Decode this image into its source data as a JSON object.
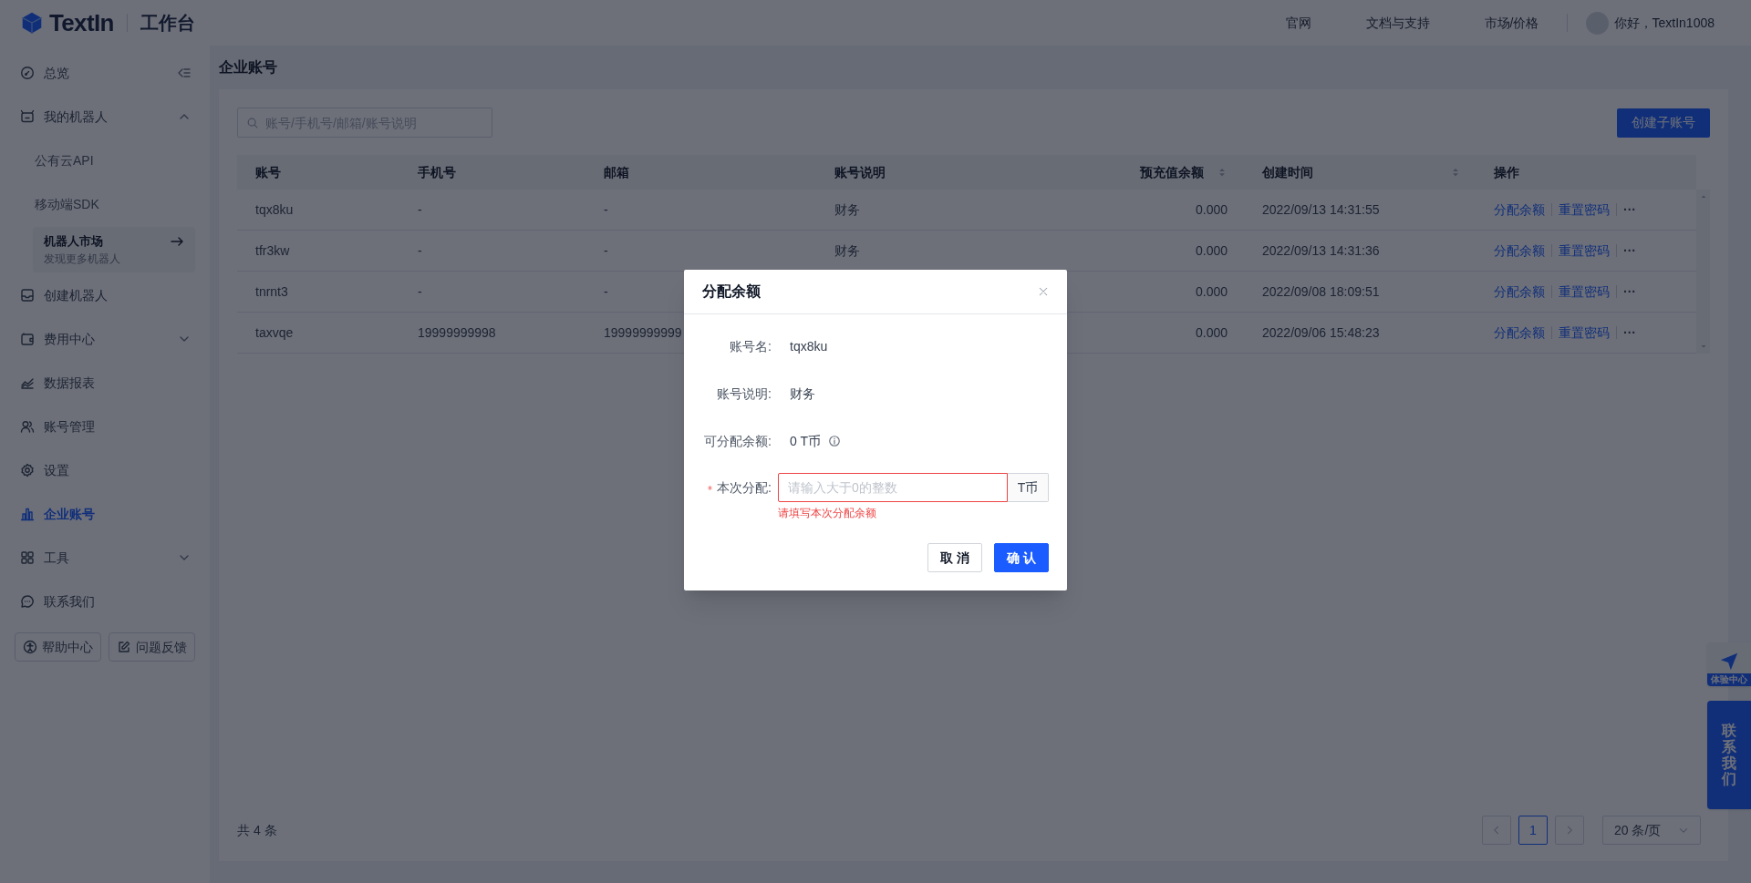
{
  "header": {
    "logo": "TextIn",
    "product": "工作台",
    "nav": [
      "官网",
      "文档与支持",
      "市场/价格"
    ],
    "greeting": "你好，TextIn1008"
  },
  "sidebar": {
    "items": [
      {
        "label": "总览",
        "kind": "item",
        "selected": false
      },
      {
        "label": "我的机器人",
        "kind": "group",
        "selected": false,
        "expanded": true,
        "children": [
          {
            "label": "公有云API",
            "selected": false
          },
          {
            "label": "移动端SDK",
            "selected": false
          }
        ],
        "promo": {
          "title": "机器人市场",
          "subtitle": "发现更多机器人"
        }
      },
      {
        "label": "创建机器人",
        "kind": "item",
        "selected": false
      },
      {
        "label": "费用中心",
        "kind": "group",
        "selected": false,
        "expanded": false
      },
      {
        "label": "数据报表",
        "kind": "item",
        "selected": false
      },
      {
        "label": "账号管理",
        "kind": "item",
        "selected": false
      },
      {
        "label": "设置",
        "kind": "item",
        "selected": false
      },
      {
        "label": "企业账号",
        "kind": "item",
        "selected": true
      },
      {
        "label": "工具",
        "kind": "group",
        "selected": false,
        "expanded": false
      },
      {
        "label": "联系我们",
        "kind": "item",
        "selected": false
      }
    ],
    "footer_buttons": [
      "帮助中心",
      "问题反馈"
    ]
  },
  "page_title": "企业账号",
  "search": {
    "placeholder": "账号/手机号/邮箱/账号说明"
  },
  "create_button": "创建子账号",
  "table": {
    "columns": [
      {
        "label": "账号",
        "sortable": false
      },
      {
        "label": "手机号",
        "sortable": false
      },
      {
        "label": "邮箱",
        "sortable": false
      },
      {
        "label": "账号说明",
        "sortable": false
      },
      {
        "label": "预充值余额",
        "sortable": true
      },
      {
        "label": "创建时间",
        "sortable": true
      },
      {
        "label": "操作",
        "sortable": false
      }
    ],
    "rows": [
      {
        "cells": [
          "tqx8ku",
          "-",
          "-",
          "财务",
          "0.000",
          "2022/09/13 14:31:55"
        ],
        "actions": [
          "分配余额",
          "重置密码",
          "···"
        ]
      },
      {
        "cells": [
          "tfr3kw",
          "-",
          "-",
          "财务",
          "0.000",
          "2022/09/13 14:31:36"
        ],
        "actions": [
          "分配余额",
          "重置密码",
          "···"
        ]
      },
      {
        "cells": [
          "tnrnt3",
          "-",
          "-",
          null,
          "0.000",
          "2022/09/08 18:09:51"
        ],
        "actions": [
          "分配余额",
          "重置密码",
          "···"
        ]
      },
      {
        "cells": [
          "taxvqe",
          "19999999998",
          "19999999999",
          null,
          "0.000",
          "2022/09/06 15:48:23"
        ],
        "actions": [
          "分配余额",
          "重置密码",
          "···"
        ]
      }
    ]
  },
  "pagination": {
    "total": "共 4 条",
    "pages": [
      {
        "label": "1",
        "selected": true
      }
    ],
    "page_size": "20 条/页"
  },
  "float_widgets": {
    "experience": "体验中心",
    "contact": "联系我们"
  },
  "modal": {
    "title": "分配余额",
    "fields": [
      {
        "kind": "text",
        "label": "账号名:",
        "value": "tqx8ku"
      },
      {
        "kind": "text",
        "label": "账号说明:",
        "value": "财务"
      },
      {
        "kind": "info",
        "label": "可分配余额:",
        "value": "0 T币"
      }
    ],
    "input": {
      "required": true,
      "label": "本次分配:",
      "placeholder": "请输入大于0的整数",
      "suffix": "T币",
      "error": "请填写本次分配余额"
    },
    "buttons": [
      {
        "label": "取 消",
        "kind": "default"
      },
      {
        "label": "确 认",
        "kind": "primary"
      }
    ]
  }
}
